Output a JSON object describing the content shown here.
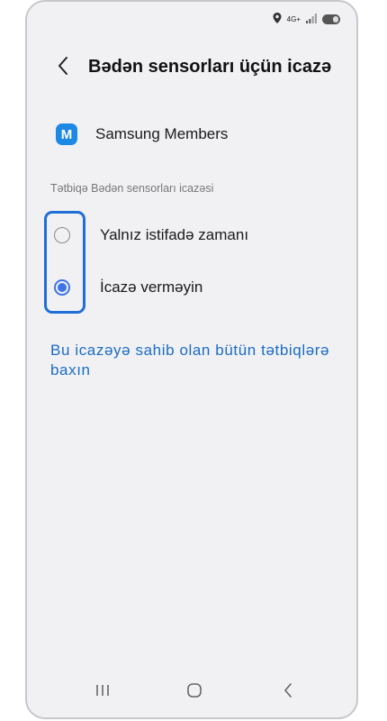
{
  "status_bar": {
    "network_label": "4G+",
    "icons": [
      "location-icon",
      "signal-icon",
      "battery-icon"
    ]
  },
  "header": {
    "title": "Bədən sensorları üçün icazə",
    "back_icon": "chevron-left-icon"
  },
  "app": {
    "name": "Samsung Members",
    "icon_letter": "M",
    "icon_color": "#1e88e5"
  },
  "permission": {
    "section_label": "Tətbiqə Bədən sensorları icazəsi",
    "options": [
      {
        "label": "Yalnız istifadə zamanı",
        "selected": false
      },
      {
        "label": "İcazə verməyin",
        "selected": true
      }
    ]
  },
  "link": {
    "text": "Bu icazəyə sahib olan bütün tətbiqlərə baxın"
  },
  "colors": {
    "accent": "#3e74e8",
    "highlight": "#1f6fd6",
    "link": "#1b6cc4",
    "background": "#f1f1f4"
  },
  "nav_bar": {
    "icons": [
      "recents-icon",
      "home-icon",
      "back-icon"
    ]
  }
}
